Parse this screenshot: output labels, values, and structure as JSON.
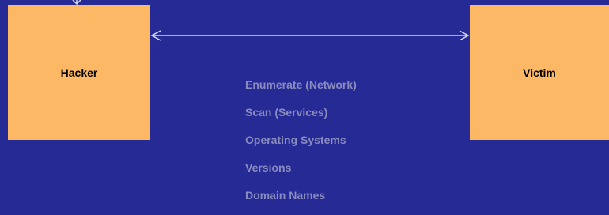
{
  "colors": {
    "background": "#262a94",
    "box_fill": "#fcb865",
    "arrow": "#d8d8f0",
    "step_text": "#8a8bbf"
  },
  "nodes": {
    "hacker": {
      "label": "Hacker"
    },
    "victim": {
      "label": "Victim"
    }
  },
  "connector": {
    "type": "bidirectional-arrow",
    "from": "hacker",
    "to": "victim"
  },
  "steps": [
    "Enumerate (Network)",
    "Scan (Services)",
    "Operating Systems",
    "Versions",
    "Domain Names"
  ]
}
